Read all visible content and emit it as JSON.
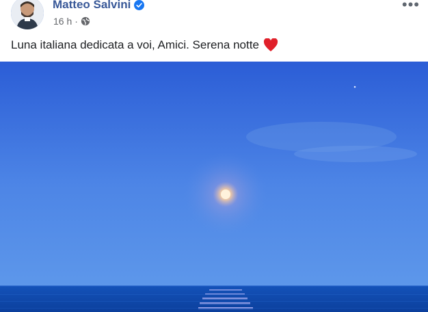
{
  "post": {
    "author": "Matteo Salvini",
    "time": "16 h",
    "dot": "·",
    "privacy_icon": "globe-icon",
    "more_label": "•••",
    "text": "Luna italiana dedicata a voi, Amici. Serena notte",
    "emoji": "heart-icon"
  },
  "colors": {
    "author_link": "#385898",
    "sky_top": "#2c5fd8",
    "sky_bottom": "#5b95ea",
    "sea": "#0f4fb7",
    "moon": "#ffd9b0"
  }
}
